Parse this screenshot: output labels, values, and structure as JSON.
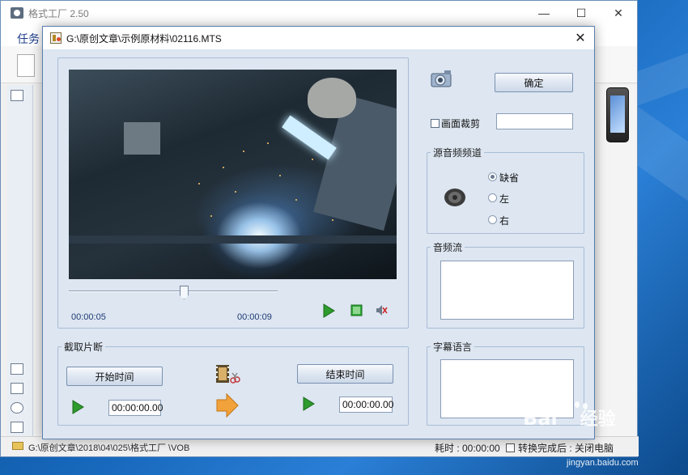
{
  "background_app": {
    "title": "格式工厂 2.50",
    "menu_task": "任务",
    "status_path": "G:\\原创文章\\2018\\04\\025\\格式工厂 \\VOB",
    "status_time": "耗时 : 00:00:00",
    "status_after": "转换完成后 : 关闭电脑",
    "window_controls": [
      "—",
      "☐",
      "✕"
    ]
  },
  "dialog": {
    "title": "G:\\原创文章\\示例原材料\\02116.MTS",
    "close_glyph": "✕",
    "confirm_label": "确定",
    "crop_label": "画面裁剪",
    "crop_value": "",
    "source_audio_channel": {
      "label": "源音频频道",
      "options": [
        "缺省",
        "左",
        "右"
      ],
      "selected": "缺省"
    },
    "audio_stream_label": "音频流",
    "subtitle_language_label": "字幕语言",
    "playback": {
      "current_time": "00:00:05",
      "end_time": "00:00:09",
      "slider_position": 0.55
    },
    "clip": {
      "label": "截取片断",
      "start_button": "开始时间",
      "end_button": "结束时间",
      "start_value": "00:00:00.00",
      "end_value": "00:00:00.00"
    }
  },
  "watermark": {
    "brand": "Bai",
    "brand_suffix": "经验",
    "url": "jingyan.baidu.com"
  },
  "colors": {
    "dialog_bg": "#dde6f1",
    "accent_text": "#1e3a73",
    "play_green": "#2d9b2d"
  }
}
